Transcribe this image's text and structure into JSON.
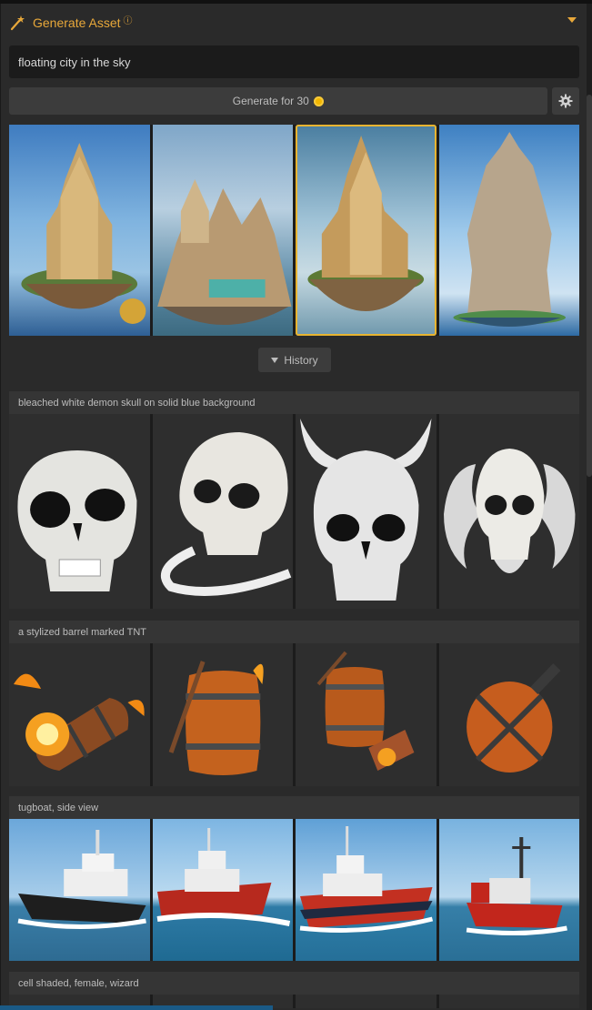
{
  "header": {
    "title": "Generate Asset",
    "info_icon": "info-icon",
    "icon": "magic-wand-icon",
    "accent": "#e8a83a"
  },
  "prompt": {
    "value": "floating city in the sky"
  },
  "generate": {
    "label": "Generate for 30",
    "coin_icon": "coin-icon",
    "settings_icon": "gear-icon"
  },
  "current_results": [
    "floating castle city",
    "floating spires city",
    "floating golden castle",
    "tall tiered tower city"
  ],
  "history": {
    "label": "History"
  },
  "sections": [
    {
      "title": "bleached white demon skull on solid blue background"
    },
    {
      "title": "a stylized barrel marked TNT"
    },
    {
      "title": "tugboat, side view"
    },
    {
      "title": "cell shaded, female, wizard"
    }
  ]
}
